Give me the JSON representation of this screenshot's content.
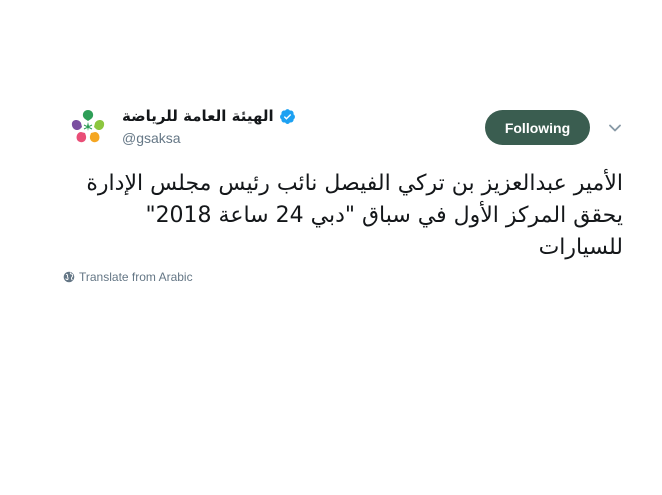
{
  "account": {
    "display_name": "الهيئة العامة للرياضة",
    "handle": "@gsaksa",
    "verified": true,
    "avatar_icon": "saudi-sports-authority-logo"
  },
  "actions": {
    "follow_label": "Following",
    "menu_icon": "chevron-down-icon"
  },
  "tweet": {
    "lines": [
      "الأمير عبدالعزيز بن تركي الفيصل نائب رئيس مجلس الإدارة",
      "يحقق المركز الأول في  سباق \"دبي 24 ساعة 2018\"",
      "للسيارات"
    ]
  },
  "translate": {
    "label": "Translate from Arabic",
    "icon": "globe-icon"
  },
  "colors": {
    "follow_bg": "#3a5d50",
    "verified": "#1da1f2",
    "text_primary": "#14171a",
    "text_secondary": "#657786"
  }
}
